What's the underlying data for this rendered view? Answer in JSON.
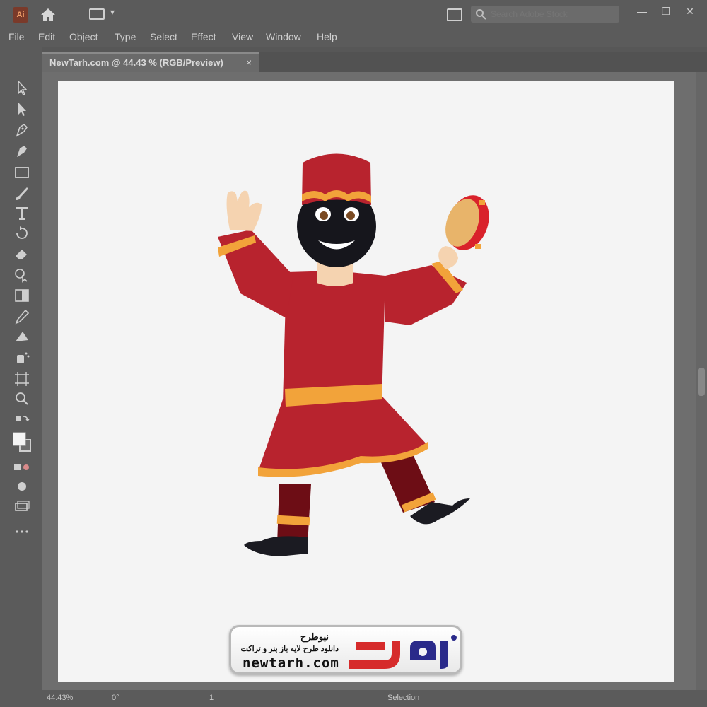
{
  "app": {
    "logo_text": "Ai",
    "search_placeholder": "Search Adobe Stock"
  },
  "menu": [
    "File",
    "Edit",
    "Object",
    "Type",
    "Select",
    "Effect",
    "View",
    "Window",
    "Help"
  ],
  "document_tab": {
    "label": "NewTarh.com @ 44.43 % (RGB/Preview)",
    "close": "×"
  },
  "window_controls": {
    "minimize": "—",
    "restore": "❐",
    "close": "✕"
  },
  "status": {
    "zoom": "44.43%",
    "rotation": "0°",
    "artboard": "1",
    "mode": "Selection"
  },
  "watermark": {
    "brand_name": "نیوطرح",
    "tagline": "دانلود طرح لایه باز بنر و تراکت",
    "url": "newtarh.com"
  },
  "colors": {
    "chrome": "#5b5b5b",
    "artboard": "#f4f4f4",
    "accent_red": "#b8232e",
    "accent_gold": "#f2a33a"
  },
  "icons": [
    "home-icon",
    "workspace-icon",
    "search-icon",
    "selection-tool-icon",
    "direct-selection-tool-icon",
    "pen-tool-icon",
    "curvature-tool-icon",
    "rectangle-tool-icon",
    "paintbrush-tool-icon",
    "type-tool-icon",
    "rotate-tool-icon",
    "eraser-tool-icon",
    "shape-builder-icon",
    "gradient-tool-icon",
    "eyedropper-tool-icon",
    "blend-tool-icon",
    "symbol-sprayer-icon",
    "artboard-tool-icon",
    "zoom-tool-icon",
    "swap-colors-icon",
    "fill-swatch-icon",
    "drawing-mode-icon",
    "screen-mode-icon",
    "more-tools-icon"
  ]
}
